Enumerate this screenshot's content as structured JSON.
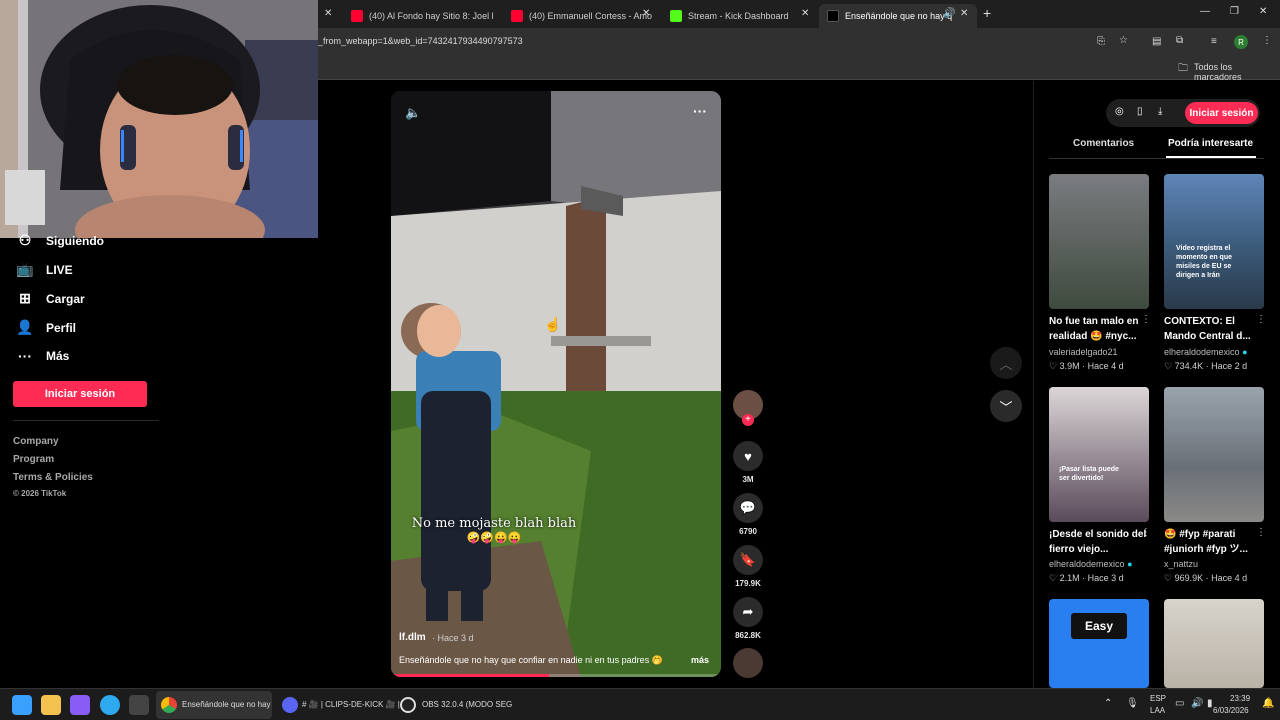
{
  "browser": {
    "tabs": [
      {
        "label": "(40) Al Fondo hay Sitio 8: Joel l",
        "icon": "youtube-icon",
        "color": "#ff0033"
      },
      {
        "label": "(40) Emmanuell Cortess - Amo",
        "icon": "youtube-icon",
        "color": "#ff0033"
      },
      {
        "label": "Stream - Kick Dashboard",
        "icon": "kick-icon",
        "color": "#53fc18"
      },
      {
        "label": "Enseñándole que no hay q",
        "icon": "tiktok-icon",
        "color": "#ffffff"
      }
    ],
    "url": "_from_webapp=1&web_id=7432417934490797573",
    "bookmarks_label": "Todos los marcadores",
    "profile_initial": "R"
  },
  "sidebar": {
    "items": [
      {
        "label": "Siguiendo",
        "icon": "following-icon"
      },
      {
        "label": "LIVE",
        "icon": "live-icon"
      },
      {
        "label": "Cargar",
        "icon": "upload-icon"
      },
      {
        "label": "Perfil",
        "icon": "profile-icon"
      },
      {
        "label": "Más",
        "icon": "more-icon"
      }
    ],
    "login_button": "Iniciar sesión",
    "footer": [
      "Company",
      "Program",
      "Terms & Policies"
    ],
    "copyright": "© 2026 TikTok"
  },
  "video": {
    "caption_overlay": "No me mojaste blah blah",
    "caption_emoji": "🤪🤪😛😛",
    "author": "lf.dlm",
    "age": "· Hace 3 d",
    "description": "Enseñándole que no hay que confiar en nadie ni en tus padres 🤭",
    "more_label": "más",
    "progress": 0.48
  },
  "actions": {
    "likes": "3M",
    "comments": "6790",
    "saves": "179.9K",
    "shares": "862.8K"
  },
  "right_panel": {
    "login_button": "Iniciar sesión",
    "tabs": [
      "Comentarios",
      "Podría interesarte"
    ],
    "active_tab": "Podría interesarte",
    "videos": [
      {
        "title": "No fue tan malo en realidad 🤩 #nyc...",
        "author": "valeriadelgado21",
        "verified": false,
        "likes": "3.9M",
        "age": "Hace 4 d",
        "thumb_text": ""
      },
      {
        "title": "CONTEXTO: El Mando Central d...",
        "author": "elheraldodemexico",
        "verified": true,
        "likes": "734.4K",
        "age": "Hace 2 d",
        "thumb_text": "Video registra el momento en que misiles de EU se dirigen a Irán"
      },
      {
        "title": "¡Desde el sonido del fierro viejo...",
        "author": "elheraldodemexico",
        "verified": true,
        "likes": "2.1M",
        "age": "Hace 3 d",
        "thumb_text": "¡Pasar lista puede ser divertido!"
      },
      {
        "title": "🤩 #fyp #parati #juniorh #fyp ツ...",
        "author": "x_nattzu",
        "verified": false,
        "likes": "969.9K",
        "age": "Hace 4 d",
        "thumb_text": ""
      },
      {
        "title": "",
        "author": "",
        "verified": false,
        "likes": "",
        "age": "",
        "thumb_text": "Easy"
      },
      {
        "title": "",
        "author": "",
        "verified": false,
        "likes": "",
        "age": "",
        "thumb_text": ""
      }
    ]
  },
  "taskbar": {
    "apps": [
      {
        "label": "Enseñándole que no hay",
        "icon": "chrome-icon"
      },
      {
        "label": "# 🎥 | CLIPS-DE-KICK 🎥 |",
        "icon": "discord-icon"
      },
      {
        "label": "OBS 32.0.4 (MODO SEG",
        "icon": "obs-icon"
      }
    ],
    "lang": "ESP",
    "lang2": "LAA",
    "time": "23:39",
    "date": "6/03/2026"
  }
}
